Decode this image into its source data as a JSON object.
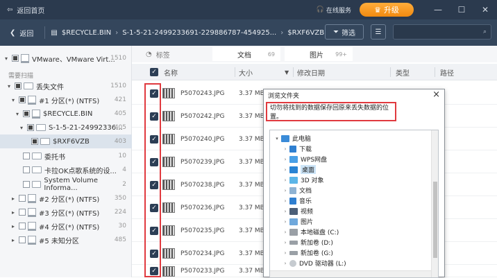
{
  "titlebar": {
    "back_home": "返回首页",
    "online_service": "在线服务",
    "upgrade": "升级",
    "minimize": "—",
    "maximize": "☐",
    "close": "✕"
  },
  "pathbar": {
    "back": "返回",
    "crumbs": [
      "$RECYCLE.BIN",
      "S-1-5-21-2499233691-229886787-454925...",
      "$RXF6VZB"
    ],
    "filter": "筛选"
  },
  "sidebar": {
    "root": {
      "label": "VMware、VMware Virt...",
      "count": "1510"
    },
    "section_label": "需要扫描",
    "items": [
      {
        "label": "丢失文件",
        "count": "1510"
      },
      {
        "label": "#1 分区(*) (NTFS)",
        "count": "421"
      },
      {
        "label": "$RECYCLE.BIN",
        "count": "405"
      },
      {
        "label": "S-1-5-21-24992336...",
        "count": "405"
      },
      {
        "label": "$RXF6VZB",
        "count": "403"
      },
      {
        "label": "委托书",
        "count": "10"
      },
      {
        "label": "卡拉OK点歌系统的设...",
        "count": "4"
      },
      {
        "label": "System Volume Informa...",
        "count": "2"
      },
      {
        "label": "#2 分区(*) (NTFS)",
        "count": "350"
      },
      {
        "label": "#3 分区(*) (NTFS)",
        "count": "224"
      },
      {
        "label": "#4 分区(*) (NTFS)",
        "count": "30"
      },
      {
        "label": "#5 未知分区",
        "count": "485"
      }
    ]
  },
  "main": {
    "tag_label": "标签",
    "tabs": [
      {
        "label": "文档",
        "count": "69"
      },
      {
        "label": "图片",
        "count": "99+"
      }
    ],
    "columns": {
      "name": "名称",
      "size": "大小",
      "modified": "修改日期",
      "type": "类型",
      "path": "路径"
    },
    "rows": [
      {
        "name": "P5070243.JPG",
        "size": "3.37 MB"
      },
      {
        "name": "P5070242.JPG",
        "size": "3.37 MB"
      },
      {
        "name": "P5070240.JPG",
        "size": "3.37 MB"
      },
      {
        "name": "P5070239.JPG",
        "size": "3.37 MB"
      },
      {
        "name": "P5070238.JPG",
        "size": "3.37 MB"
      },
      {
        "name": "P5070236.JPG",
        "size": "3.37 MB"
      },
      {
        "name": "P5070235.JPG",
        "size": "3.37 MB"
      },
      {
        "name": "P5070234.JPG",
        "size": "3.37 MB"
      },
      {
        "name": "P5070233.JPG",
        "size": "3.37 MB"
      }
    ]
  },
  "dialog": {
    "title": "浏览文件夹",
    "warning": "切勿将找到的数据保存回原来丢失数据的位置。",
    "items": [
      {
        "label": "此电脑"
      },
      {
        "label": "下载"
      },
      {
        "label": "WPS网盘"
      },
      {
        "label": "桌面"
      },
      {
        "label": "3D 对象"
      },
      {
        "label": "文档"
      },
      {
        "label": "音乐"
      },
      {
        "label": "视频"
      },
      {
        "label": "图片"
      },
      {
        "label": "本地磁盘 (C:)"
      },
      {
        "label": "新加卷 (D:)"
      },
      {
        "label": "新加卷 (G:)"
      },
      {
        "label": "DVD 驱动器 (L:)"
      }
    ]
  }
}
